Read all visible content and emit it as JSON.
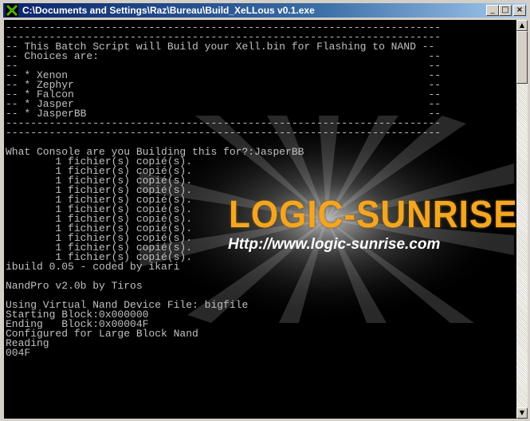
{
  "window": {
    "title": "C:\\Documents and Settings\\Raz\\Bureau\\Build_XeLLous v0.1.exe",
    "icons": {
      "app": "cmd-x-icon",
      "minimize": "minimize-icon",
      "maximize": "maximize-icon",
      "close": "close-icon"
    },
    "controls": {
      "minimize": "_",
      "maximize": "□",
      "close": "×"
    }
  },
  "logo": {
    "title": "LOGIC-SUNRISE",
    "url": "Http://www.logic-sunrise.com"
  },
  "console_lines": [
    "----------------------------------------------------------------------",
    "----------------------------------------------------------------------",
    "-- This Batch Script will Build your Xell.bin for Flashing to NAND --",
    "-- Choices are:                                                     --",
    "--                                                                  --",
    "-- * Xenon                                                          --",
    "-- * Zephyr                                                         --",
    "-- * Falcon                                                         --",
    "-- * Jasper                                                         --",
    "-- * JasperBB                                                       --",
    "----------------------------------------------------------------------",
    "----------------------------------------------------------------------",
    "",
    "What Console are you Building this for?:JasperBB",
    "        1 fichier(s) copié(s).",
    "        1 fichier(s) copié(s).",
    "        1 fichier(s) copié(s).",
    "        1 fichier(s) copié(s).",
    "        1 fichier(s) copié(s).",
    "        1 fichier(s) copié(s).",
    "        1 fichier(s) copié(s).",
    "        1 fichier(s) copié(s).",
    "        1 fichier(s) copié(s).",
    "        1 fichier(s) copié(s).",
    "        1 fichier(s) copié(s).",
    "ibuild 0.05 - coded by ikari",
    "",
    "NandPro v2.0b by Tiros",
    "",
    "Using Virtual Nand Device File: bigfile",
    "Starting Block:0x000000",
    "Ending   Block:0x00004F",
    "Configured for Large Block Nand",
    "Reading",
    "004F"
  ],
  "scrollbar": {
    "up": "▲",
    "down": "▼"
  },
  "colors": {
    "console_bg": "#000000",
    "console_text": "#c0c0c0",
    "logo_orange": "#f2a622",
    "title_blue": "#0a246a"
  }
}
